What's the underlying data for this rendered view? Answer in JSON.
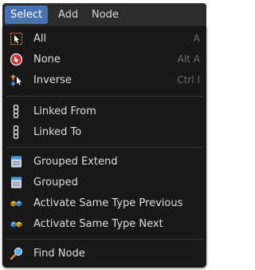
{
  "menubar": {
    "items": [
      {
        "label": "Select",
        "active": true
      },
      {
        "label": "Add",
        "active": false
      },
      {
        "label": "Node",
        "active": false
      }
    ]
  },
  "dropdown": {
    "items": [
      {
        "label": "All",
        "shortcut": "A",
        "icon": "select-all-icon"
      },
      {
        "label": "None",
        "shortcut": "Alt A",
        "icon": "select-none-icon"
      },
      {
        "label": "Inverse",
        "shortcut": "Ctrl I",
        "icon": "select-inverse-icon"
      },
      {
        "label": "Linked From",
        "shortcut": "",
        "icon": "linked-from-icon"
      },
      {
        "label": "Linked To",
        "shortcut": "",
        "icon": "linked-to-icon"
      },
      {
        "label": "Grouped Extend",
        "shortcut": "",
        "icon": "grouped-extend-icon"
      },
      {
        "label": "Grouped",
        "shortcut": "",
        "icon": "grouped-icon"
      },
      {
        "label": "Activate Same Type Previous",
        "shortcut": "",
        "icon": "same-type-previous-icon"
      },
      {
        "label": "Activate Same Type Next",
        "shortcut": "",
        "icon": "same-type-next-icon"
      },
      {
        "label": "Find Node",
        "shortcut": "",
        "icon": "find-node-icon"
      }
    ]
  },
  "colors": {
    "menubar_bg": "#2b2b2b",
    "active_tab": "#4772b3",
    "dropdown_bg": "#181818",
    "text": "#dedede",
    "shortcut_text": "#6e6e6e",
    "separator": "#333333"
  }
}
